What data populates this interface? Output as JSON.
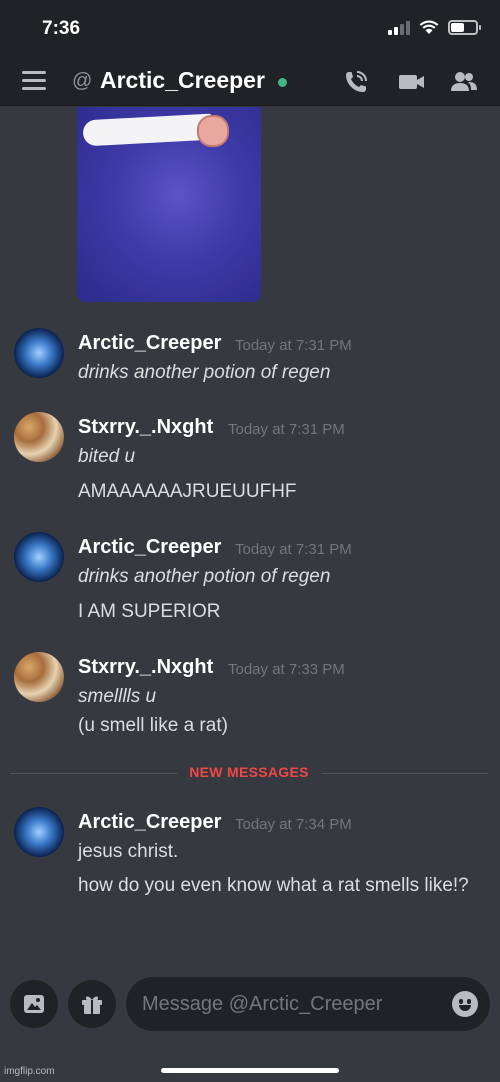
{
  "status_bar": {
    "time": "7:36"
  },
  "header": {
    "channel_name": "Arctic_Creeper"
  },
  "messages": [
    {
      "username": "Arctic_Creeper",
      "timestamp": "Today at 7:31 PM",
      "lines": [
        "drinks another potion of regen"
      ]
    },
    {
      "username": "Stxrry._.Nxght",
      "timestamp": "Today at 7:31 PM",
      "lines": [
        "bited u",
        "AMAAAAAAJRUEUUFHF"
      ]
    },
    {
      "username": "Arctic_Creeper",
      "timestamp": "Today at 7:31 PM",
      "lines": [
        "drinks another potion of regen",
        "I AM SUPERIOR"
      ]
    },
    {
      "username": "Stxrry._.Nxght",
      "timestamp": "Today at 7:33 PM",
      "lines": [
        "smelllls u",
        "(u smell like a rat)"
      ]
    },
    {
      "username": "Arctic_Creeper",
      "timestamp": "Today at 7:34 PM",
      "lines": [
        "jesus christ.",
        "how do you even know what a rat smells like!?"
      ]
    }
  ],
  "divider": {
    "label": "NEW MESSAGES"
  },
  "composer": {
    "placeholder": "Message @Arctic_Creeper"
  },
  "watermark": "imgflip.com",
  "colors": {
    "accent_red": "#f04747",
    "online_green": "#43b581",
    "background": "#36393f",
    "header": "#202225"
  }
}
